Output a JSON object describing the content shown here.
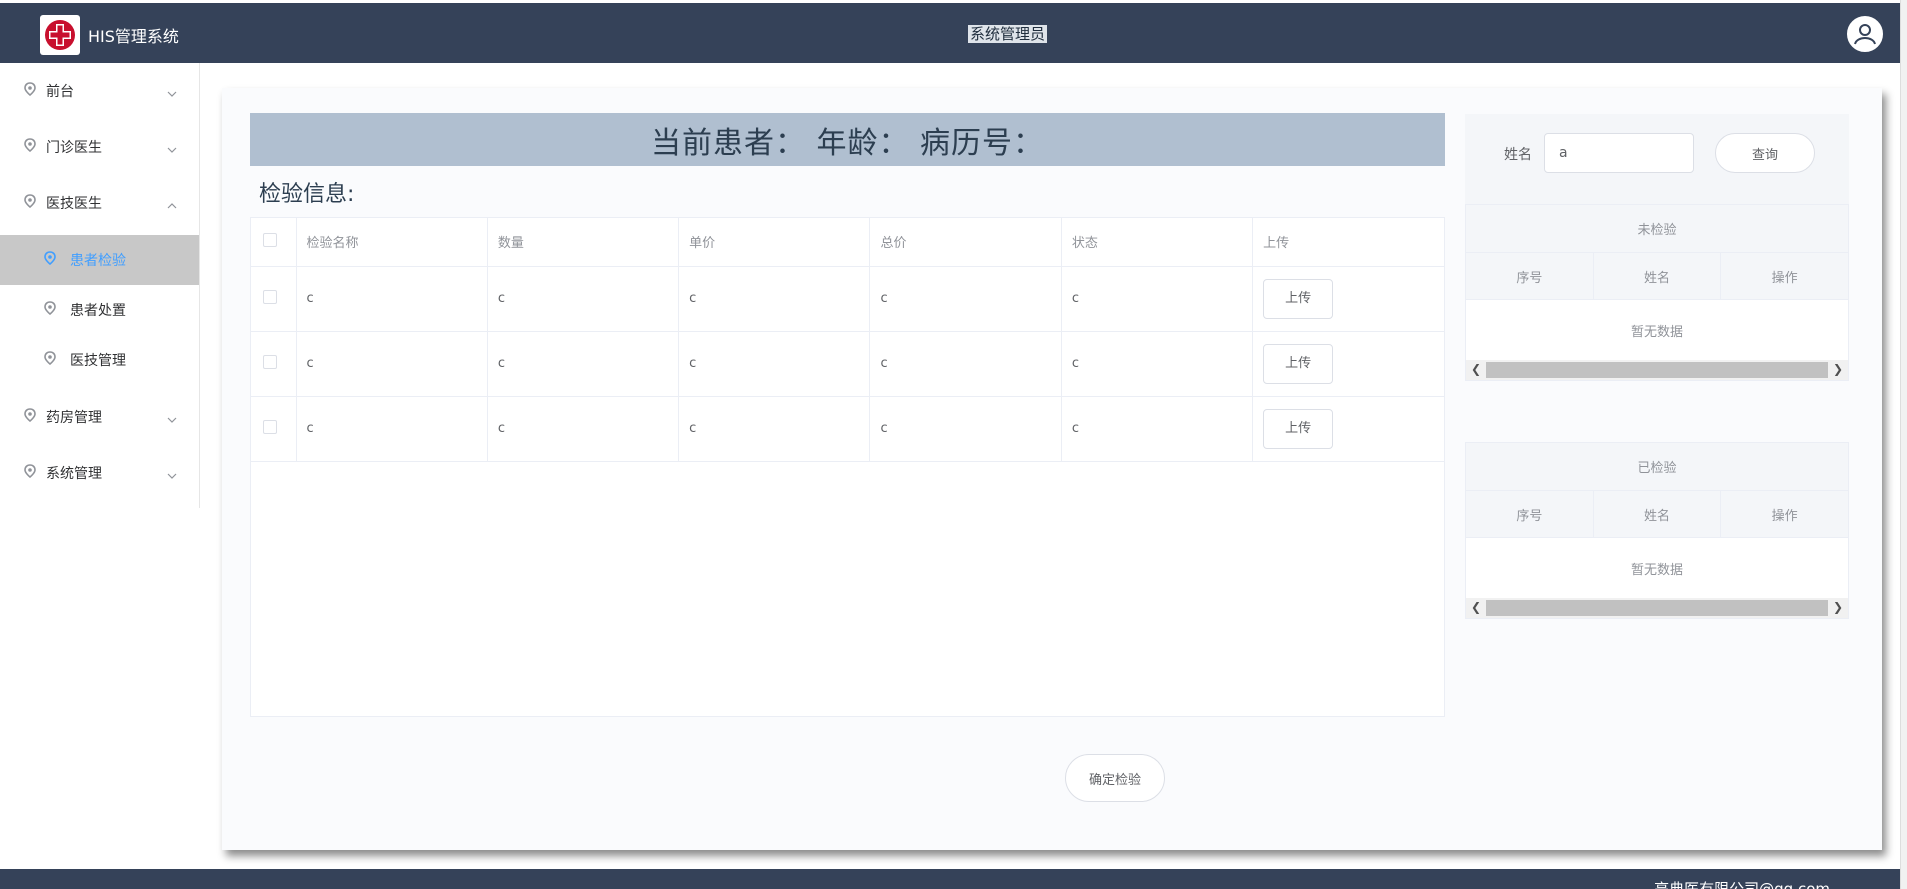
{
  "header": {
    "app_title": "HIS管理系统",
    "user_title": "系统管理员"
  },
  "sidebar": {
    "items": [
      {
        "label": "前台",
        "expanded": false
      },
      {
        "label": "门诊医生",
        "expanded": false
      },
      {
        "label": "医技医生",
        "expanded": true,
        "children": [
          {
            "label": "患者检验",
            "active": true
          },
          {
            "label": "患者处置",
            "active": false
          },
          {
            "label": "医技管理",
            "active": false
          }
        ]
      },
      {
        "label": "药房管理",
        "expanded": false
      },
      {
        "label": "系统管理",
        "expanded": false
      }
    ]
  },
  "patient_bar": {
    "text": "当前患者：  年龄：  病历号："
  },
  "section_title": "检验信息:",
  "table": {
    "headers": [
      "检验名称",
      "数量",
      "单价",
      "总价",
      "状态",
      "上传"
    ],
    "rows": [
      {
        "name": "c",
        "qty": "c",
        "price": "c",
        "total": "c",
        "status": "c",
        "action": "上传"
      },
      {
        "name": "c",
        "qty": "c",
        "price": "c",
        "total": "c",
        "status": "c",
        "action": "上传"
      },
      {
        "name": "c",
        "qty": "c",
        "price": "c",
        "total": "c",
        "status": "c",
        "action": "上传"
      }
    ]
  },
  "confirm_button": "确定检验",
  "search": {
    "label": "姓名",
    "value": "a",
    "button": "查询"
  },
  "unchecked": {
    "title": "未检验",
    "headers": [
      "序号",
      "姓名",
      "操作"
    ],
    "empty": "暂无数据"
  },
  "checked": {
    "title": "已检验",
    "headers": [
      "序号",
      "姓名",
      "操作"
    ],
    "empty": "暂无数据"
  },
  "footer": {
    "text": "亮典医有限公司@qq.com"
  },
  "colors": {
    "header_bg": "#354259",
    "patient_bar_bg": "#b0bfd0",
    "active_menu_bg": "#c8c8c8",
    "active_menu_text": "#409eff"
  }
}
